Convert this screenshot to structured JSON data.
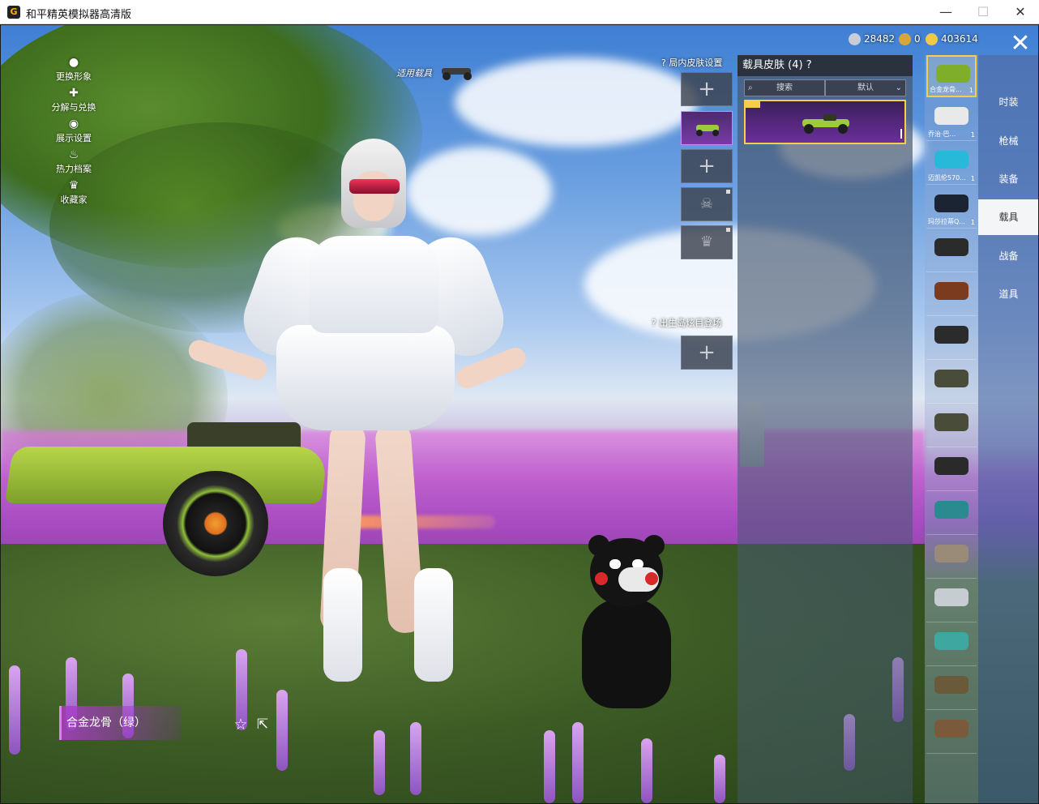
{
  "window": {
    "title": "和平精英模拟器高清版",
    "app_icon_glyph": "G",
    "minimize_glyph": "—",
    "maximize_glyph": "☐",
    "close_glyph": "✕"
  },
  "left_menu": [
    {
      "label": "更换形象",
      "icon": "person-icon",
      "glyph": "●"
    },
    {
      "label": "分解与兑换",
      "icon": "puzzle-icon",
      "glyph": "✚"
    },
    {
      "label": "展示设置",
      "icon": "eye-icon",
      "glyph": "◉"
    },
    {
      "label": "热力档案",
      "icon": "flame-icon",
      "glyph": "♨"
    },
    {
      "label": "收藏家",
      "icon": "collector-badge-icon",
      "glyph": "♛"
    }
  ],
  "applied_vehicle_label": "适用载具",
  "currency": [
    {
      "name": "silver-coin",
      "value": "28482",
      "color": "#c8cdd8"
    },
    {
      "name": "gold-coin",
      "value": "0",
      "color": "#d7a63a"
    },
    {
      "name": "coupon",
      "value": "403614",
      "color": "#f0c84a"
    }
  ],
  "close_glyph": "✕",
  "slots": {
    "heading_in_game": "局内皮肤设置",
    "heading_spawn": "出生岛炫目登场",
    "help_glyph": "?",
    "plus_glyph": "+"
  },
  "skin_panel": {
    "title": "载具皮肤 (4)",
    "help_glyph": "?",
    "search_placeholder": "搜索",
    "search_icon_glyph": "⌕",
    "sort_value": "默认",
    "sort_chevron": "⌄"
  },
  "vehicle_list": [
    {
      "label": "合金龙骨...",
      "count": "1",
      "color": "#7fae2a"
    },
    {
      "label": "乔治·巴...",
      "count": "1",
      "color": "#e9e9e9"
    },
    {
      "label": "迈凯伦570...",
      "count": "1",
      "color": "#28b9d9"
    },
    {
      "label": "玛莎拉蒂Q...",
      "count": "1",
      "color": "#1b2433"
    },
    {
      "label": "",
      "count": "",
      "color": "#2b2b2b"
    },
    {
      "label": "",
      "count": "",
      "color": "#7a3b1e"
    },
    {
      "label": "",
      "count": "",
      "color": "#2b2b2b"
    },
    {
      "label": "",
      "count": "",
      "color": "#4a4c3a"
    },
    {
      "label": "",
      "count": "",
      "color": "#4a4c3a"
    },
    {
      "label": "",
      "count": "",
      "color": "#2a2a2a"
    },
    {
      "label": "",
      "count": "",
      "color": "#2b8a8f"
    },
    {
      "label": "",
      "count": "",
      "color": "#9a8a78"
    },
    {
      "label": "",
      "count": "",
      "color": "#c7ccd2"
    },
    {
      "label": "",
      "count": "",
      "color": "#3ea8a0"
    },
    {
      "label": "",
      "count": "",
      "color": "#6a5a3a"
    },
    {
      "label": "",
      "count": "",
      "color": "#7a5a3a"
    }
  ],
  "categories": [
    {
      "label": "时装",
      "active": false
    },
    {
      "label": "枪械",
      "active": false
    },
    {
      "label": "装备",
      "active": false
    },
    {
      "label": "载具",
      "active": true
    },
    {
      "label": "战备",
      "active": false
    },
    {
      "label": "道具",
      "active": false
    }
  ],
  "item_name": "合金龙骨（绿）",
  "star_glyph": "☆",
  "share_glyph": "⇱",
  "colors": {
    "accent_gold": "#f5cf4a",
    "accent_purple": "#b04fd8",
    "panel_dark": "#28303c"
  }
}
